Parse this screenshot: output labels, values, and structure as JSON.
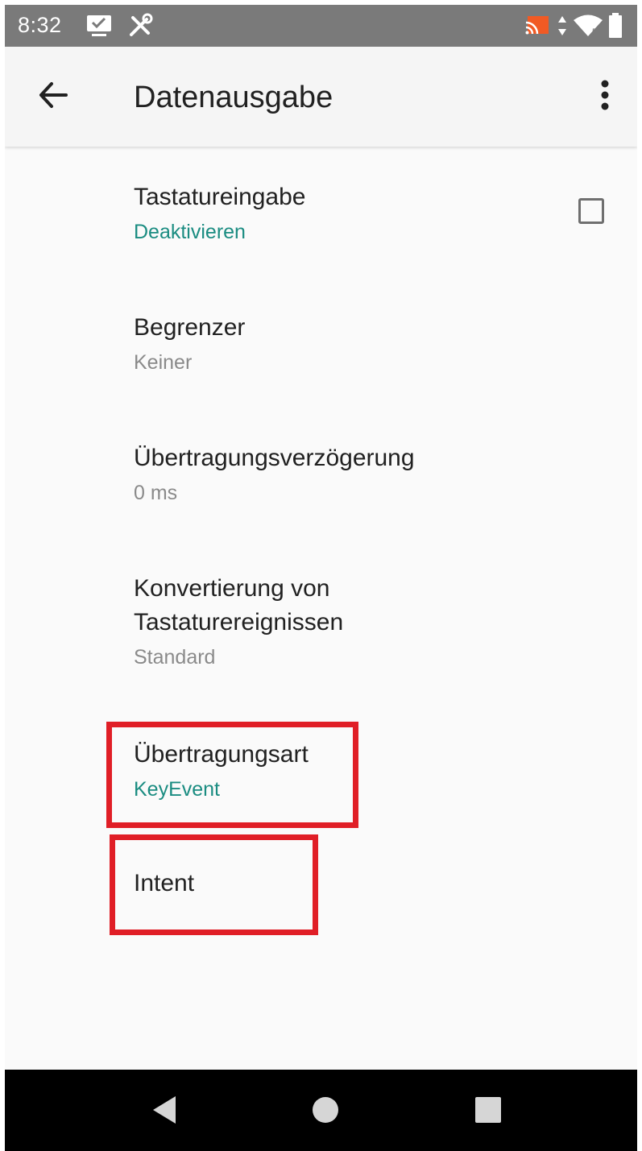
{
  "status_bar": {
    "time": "8:32",
    "left_icons": [
      "screen-monitor-icon",
      "tools-icon"
    ],
    "right_icons": [
      "cast-icon",
      "data-arrows-icon",
      "wifi-icon",
      "battery-icon"
    ]
  },
  "app_bar": {
    "title": "Datenausgabe",
    "back_icon": "arrow-back-icon",
    "menu_icon": "more-vert-icon"
  },
  "preferences": [
    {
      "title": "Tastatureingabe",
      "summary": "Deaktivieren",
      "accent": true,
      "widget": "checkbox",
      "checked": false
    },
    {
      "title": "Begrenzer",
      "summary": "Keiner",
      "accent": false
    },
    {
      "title": "Übertragungsverzögerung",
      "summary": "0 ms",
      "accent": false
    },
    {
      "title": "Konvertierung von\nTastaturereignissen",
      "summary": "Standard",
      "accent": false
    },
    {
      "title": "Übertragungsart",
      "summary": "KeyEvent",
      "accent": true,
      "highlighted": true
    },
    {
      "title": "Intent",
      "highlighted": true
    }
  ],
  "nav_bar": {
    "icons": [
      "back-triangle-icon",
      "home-circle-icon",
      "recents-square-icon"
    ]
  },
  "colors": {
    "accent": "#1a8c81",
    "highlight": "#e01e26",
    "status_bar": "#7a7a7a",
    "app_bar": "#f5f5f5",
    "background": "#fafafa"
  }
}
